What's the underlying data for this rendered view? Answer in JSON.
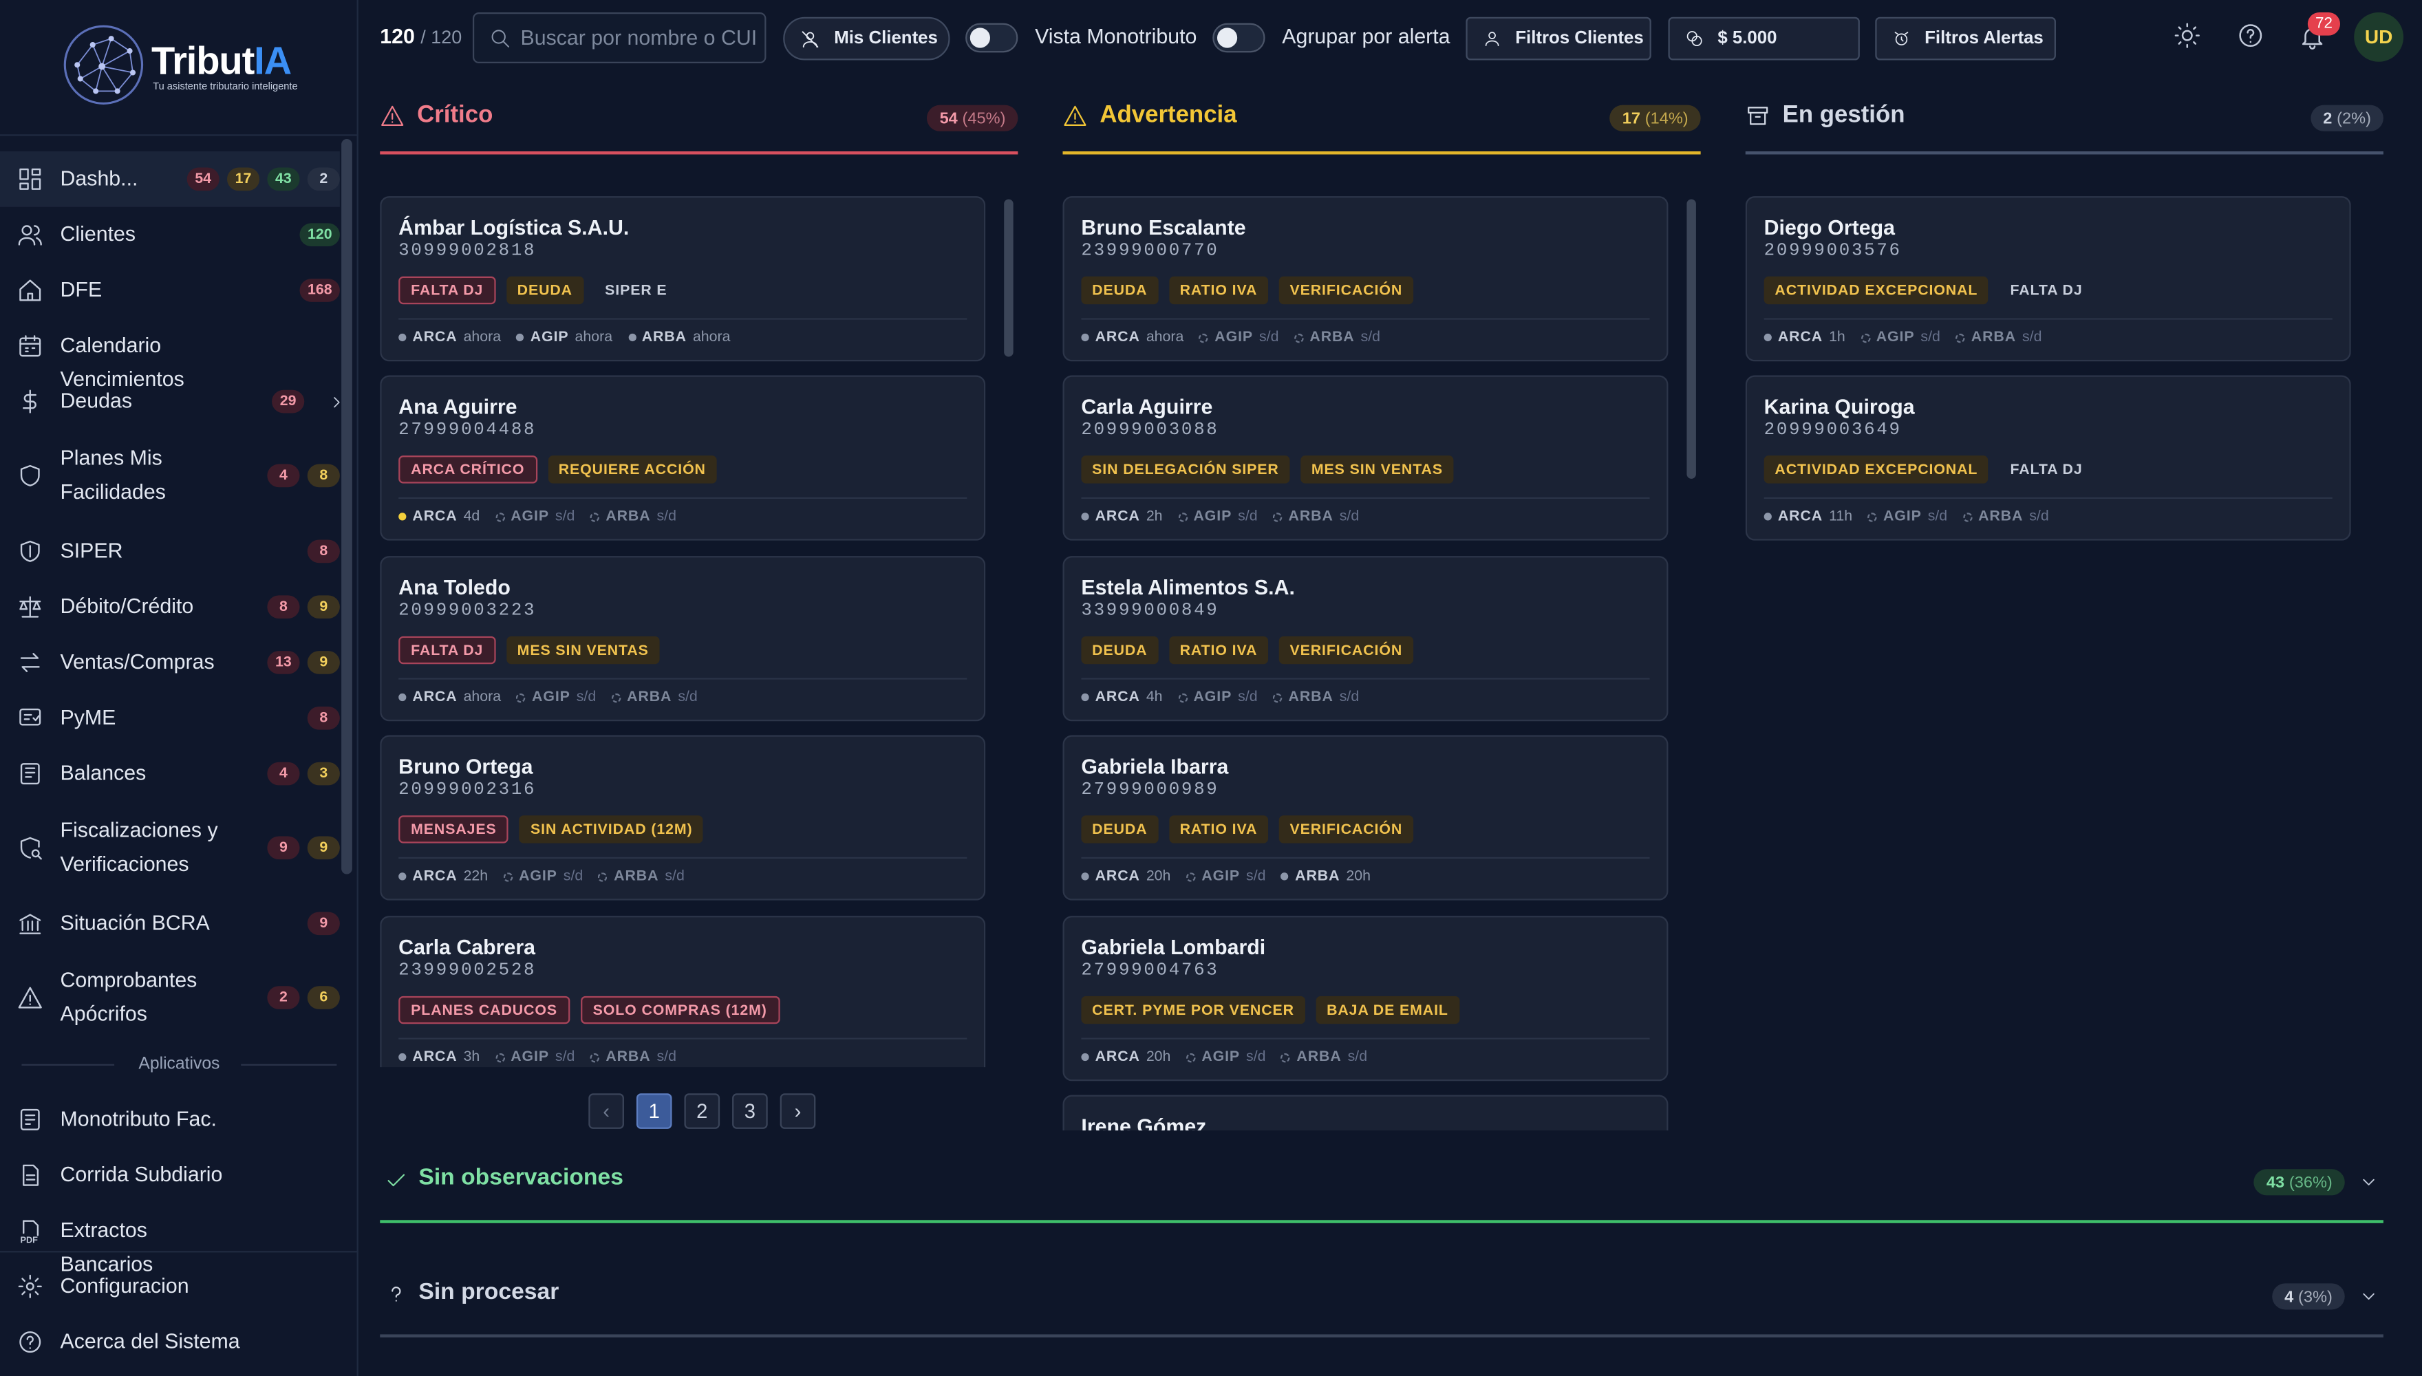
{
  "brand": {
    "name_a": "Tribut",
    "name_b": "IA",
    "tagline": "Tu asistente tributario inteligente"
  },
  "sidebar": {
    "items": [
      {
        "label": "Dashb...",
        "icon": "dashboard-icon",
        "badges": [
          {
            "v": "54",
            "c": "red"
          },
          {
            "v": "17",
            "c": "yel"
          },
          {
            "v": "43",
            "c": "grn"
          },
          {
            "v": "2",
            "c": "gry"
          }
        ]
      },
      {
        "label": "Clientes",
        "icon": "users-icon",
        "badges": [
          {
            "v": "120",
            "c": "grn"
          }
        ]
      },
      {
        "label": "DFE",
        "icon": "home-icon",
        "badges": [
          {
            "v": "168",
            "c": "red"
          }
        ]
      },
      {
        "label": "Calendario Vencimientos",
        "icon": "calendar-icon",
        "badges": []
      },
      {
        "label": "Deudas",
        "icon": "dollar-icon",
        "badges": [
          {
            "v": "29",
            "c": "red"
          }
        ]
      },
      {
        "label": "Planes Mis Facilidades",
        "icon": "shield-icon",
        "badges": [
          {
            "v": "4",
            "c": "red"
          },
          {
            "v": "8",
            "c": "yel"
          }
        ]
      },
      {
        "label": "SIPER",
        "icon": "shield-outline-icon",
        "badges": [
          {
            "v": "8",
            "c": "red"
          }
        ]
      },
      {
        "label": "Débito/Crédito",
        "icon": "scale-icon",
        "badges": [
          {
            "v": "8",
            "c": "red"
          },
          {
            "v": "9",
            "c": "yel"
          }
        ]
      },
      {
        "label": "Ventas/Compras",
        "icon": "arrows-icon",
        "badges": [
          {
            "v": "13",
            "c": "red"
          },
          {
            "v": "9",
            "c": "yel"
          }
        ]
      },
      {
        "label": "PyME",
        "icon": "pyme-icon",
        "badges": [
          {
            "v": "8",
            "c": "red"
          }
        ]
      },
      {
        "label": "Balances",
        "icon": "balance-icon",
        "badges": [
          {
            "v": "4",
            "c": "red"
          },
          {
            "v": "3",
            "c": "yel"
          }
        ]
      },
      {
        "label": "Fiscalizaciones y Verificaciones",
        "icon": "audit-icon",
        "badges": [
          {
            "v": "9",
            "c": "red"
          },
          {
            "v": "9",
            "c": "yel"
          }
        ]
      },
      {
        "label": "Situación BCRA",
        "icon": "bank-icon",
        "badges": [
          {
            "v": "9",
            "c": "red"
          }
        ]
      },
      {
        "label": "Comprobantes Apócrifos",
        "icon": "warning-icon",
        "badges": [
          {
            "v": "2",
            "c": "red"
          },
          {
            "v": "6",
            "c": "yel"
          }
        ]
      }
    ],
    "apps_label": "Aplicativos",
    "apps": [
      {
        "label": "Monotributo Fac.",
        "icon": "receipt-icon"
      },
      {
        "label": "Corrida Subdiario",
        "icon": "document-icon"
      },
      {
        "label": "Extractos Bancarios",
        "icon": "pdf-icon"
      }
    ],
    "bottom": [
      {
        "label": "Configuracion",
        "icon": "gear-icon"
      },
      {
        "label": "Acerca del Sistema",
        "icon": "help-icon"
      }
    ]
  },
  "topbar": {
    "count": "120",
    "total": "/ 120",
    "search_placeholder": "Buscar por nombre o CUIT",
    "mis_clientes": "Mis Clientes",
    "vista_monotributo": "Vista Monotributo",
    "agrupar": "Agrupar por alerta",
    "filtros_clientes": "Filtros Clientes",
    "amount": "$ 5.000",
    "filtros_alertas": "Filtros Alertas",
    "notifications": "72",
    "avatar": "UD"
  },
  "columns": [
    {
      "title": "Crítico",
      "count": "54",
      "pct": "(45%)",
      "color": "#f07c8a",
      "line": "#d8505f",
      "badge_bg": "#3b1d2a",
      "badge_fg": "#f49aa9",
      "icon": "warning-icon",
      "cards": [
        {
          "name": "Ámbar Logística S.A.U.",
          "cuit": "30999002818",
          "tags": [
            [
              "FALTA DJ",
              "r"
            ],
            [
              "DEUDA",
              "y"
            ],
            [
              "SIPER E",
              "g"
            ]
          ],
          "status": [
            [
              "ARCA",
              "ahora",
              1
            ],
            [
              "AGIP",
              "ahora",
              1
            ],
            [
              "ARBA",
              "ahora",
              1
            ]
          ]
        },
        {
          "name": "Ana Aguirre",
          "cuit": "27999004488",
          "tags": [
            [
              "ARCA CRÍTICO",
              "r"
            ],
            [
              "REQUIERE ACCIÓN",
              "y"
            ]
          ],
          "status": [
            [
              "ARCA",
              "4d",
              2
            ],
            [
              "AGIP",
              "s/d",
              0
            ],
            [
              "ARBA",
              "s/d",
              0
            ]
          ]
        },
        {
          "name": "Ana Toledo",
          "cuit": "20999003223",
          "tags": [
            [
              "FALTA DJ",
              "r"
            ],
            [
              "MES SIN VENTAS",
              "y"
            ]
          ],
          "status": [
            [
              "ARCA",
              "ahora",
              1
            ],
            [
              "AGIP",
              "s/d",
              0
            ],
            [
              "ARBA",
              "s/d",
              0
            ]
          ]
        },
        {
          "name": "Bruno Ortega",
          "cuit": "20999002316",
          "tags": [
            [
              "MENSAJES",
              "r"
            ],
            [
              "SIN ACTIVIDAD (12M)",
              "y"
            ]
          ],
          "status": [
            [
              "ARCA",
              "22h",
              1
            ],
            [
              "AGIP",
              "s/d",
              0
            ],
            [
              "ARBA",
              "s/d",
              0
            ]
          ]
        },
        {
          "name": "Carla Cabrera",
          "cuit": "23999002528",
          "tags": [
            [
              "PLANES CADUCOS",
              "r"
            ],
            [
              "SOLO COMPRAS (12M)",
              "r"
            ]
          ],
          "status": [
            [
              "ARCA",
              "3h",
              1
            ],
            [
              "AGIP",
              "s/d",
              0
            ],
            [
              "ARBA",
              "s/d",
              0
            ]
          ]
        }
      ]
    },
    {
      "title": "Advertencia",
      "count": "17",
      "pct": "(14%)",
      "color": "#f2c636",
      "line": "#e3b62a",
      "badge_bg": "#3a3320",
      "badge_fg": "#f2cf5c",
      "icon": "warning-icon",
      "cards": [
        {
          "name": "Bruno Escalante",
          "cuit": "23999000770",
          "tags": [
            [
              "DEUDA",
              "y"
            ],
            [
              "RATIO IVA",
              "y"
            ],
            [
              "VERIFICACIÓN",
              "y"
            ]
          ],
          "status": [
            [
              "ARCA",
              "ahora",
              1
            ],
            [
              "AGIP",
              "s/d",
              0
            ],
            [
              "ARBA",
              "s/d",
              0
            ]
          ]
        },
        {
          "name": "Carla Aguirre",
          "cuit": "20999003088",
          "tags": [
            [
              "SIN DELEGACIÓN SIPER",
              "y"
            ],
            [
              "MES SIN VENTAS",
              "y"
            ]
          ],
          "status": [
            [
              "ARCA",
              "2h",
              1
            ],
            [
              "AGIP",
              "s/d",
              0
            ],
            [
              "ARBA",
              "s/d",
              0
            ]
          ]
        },
        {
          "name": "Estela Alimentos S.A.",
          "cuit": "33999000849",
          "tags": [
            [
              "DEUDA",
              "y"
            ],
            [
              "RATIO IVA",
              "y"
            ],
            [
              "VERIFICACIÓN",
              "y"
            ]
          ],
          "status": [
            [
              "ARCA",
              "4h",
              1
            ],
            [
              "AGIP",
              "s/d",
              0
            ],
            [
              "ARBA",
              "s/d",
              0
            ]
          ]
        },
        {
          "name": "Gabriela Ibarra",
          "cuit": "27999000989",
          "tags": [
            [
              "DEUDA",
              "y"
            ],
            [
              "RATIO IVA",
              "y"
            ],
            [
              "VERIFICACIÓN",
              "y"
            ]
          ],
          "status": [
            [
              "ARCA",
              "20h",
              1
            ],
            [
              "AGIP",
              "s/d",
              0
            ],
            [
              "ARBA",
              "20h",
              1
            ]
          ]
        },
        {
          "name": "Gabriela Lombardi",
          "cuit": "27999004763",
          "tags": [
            [
              "CERT. PYME POR VENCER",
              "y"
            ],
            [
              "BAJA DE EMAIL",
              "y"
            ]
          ],
          "status": [
            [
              "ARCA",
              "20h",
              1
            ],
            [
              "AGIP",
              "s/d",
              0
            ],
            [
              "ARBA",
              "s/d",
              0
            ]
          ]
        },
        {
          "name": "Irene Gómez",
          "cuit": "",
          "tags": [],
          "status": []
        }
      ]
    },
    {
      "title": "En gestión",
      "count": "2",
      "pct": "(2%)",
      "color": "#d3d9e5",
      "line": "#46536d",
      "badge_bg": "#262f42",
      "badge_fg": "#cfd6e3",
      "icon": "archive-icon",
      "cards": [
        {
          "name": "Diego Ortega",
          "cuit": "20999003576",
          "tags": [
            [
              "ACTIVIDAD EXCEPCIONAL",
              "y"
            ],
            [
              "FALTA DJ",
              "g"
            ]
          ],
          "status": [
            [
              "ARCA",
              "1h",
              1
            ],
            [
              "AGIP",
              "s/d",
              0
            ],
            [
              "ARBA",
              "s/d",
              0
            ]
          ]
        },
        {
          "name": "Karina Quiroga",
          "cuit": "20999003649",
          "tags": [
            [
              "ACTIVIDAD EXCEPCIONAL",
              "y"
            ],
            [
              "FALTA DJ",
              "g"
            ]
          ],
          "status": [
            [
              "ARCA",
              "11h",
              1
            ],
            [
              "AGIP",
              "s/d",
              0
            ],
            [
              "ARBA",
              "s/d",
              0
            ]
          ]
        }
      ]
    }
  ],
  "pager": {
    "pages": [
      "1",
      "2",
      "3"
    ],
    "current": "1",
    "prev": "‹",
    "next": "›"
  },
  "sections": [
    {
      "title": "Sin observaciones",
      "count": "43",
      "pct": "(36%)",
      "color": "#7fe0a4",
      "line": "#3fbf6a",
      "badge_bg": "#1b3a2e",
      "icon": "check-icon"
    },
    {
      "title": "Sin procesar",
      "count": "4",
      "pct": "(3%)",
      "color": "#d3d9e5",
      "line": "#3a4459",
      "badge_bg": "#262f42",
      "icon": "question-icon"
    }
  ]
}
